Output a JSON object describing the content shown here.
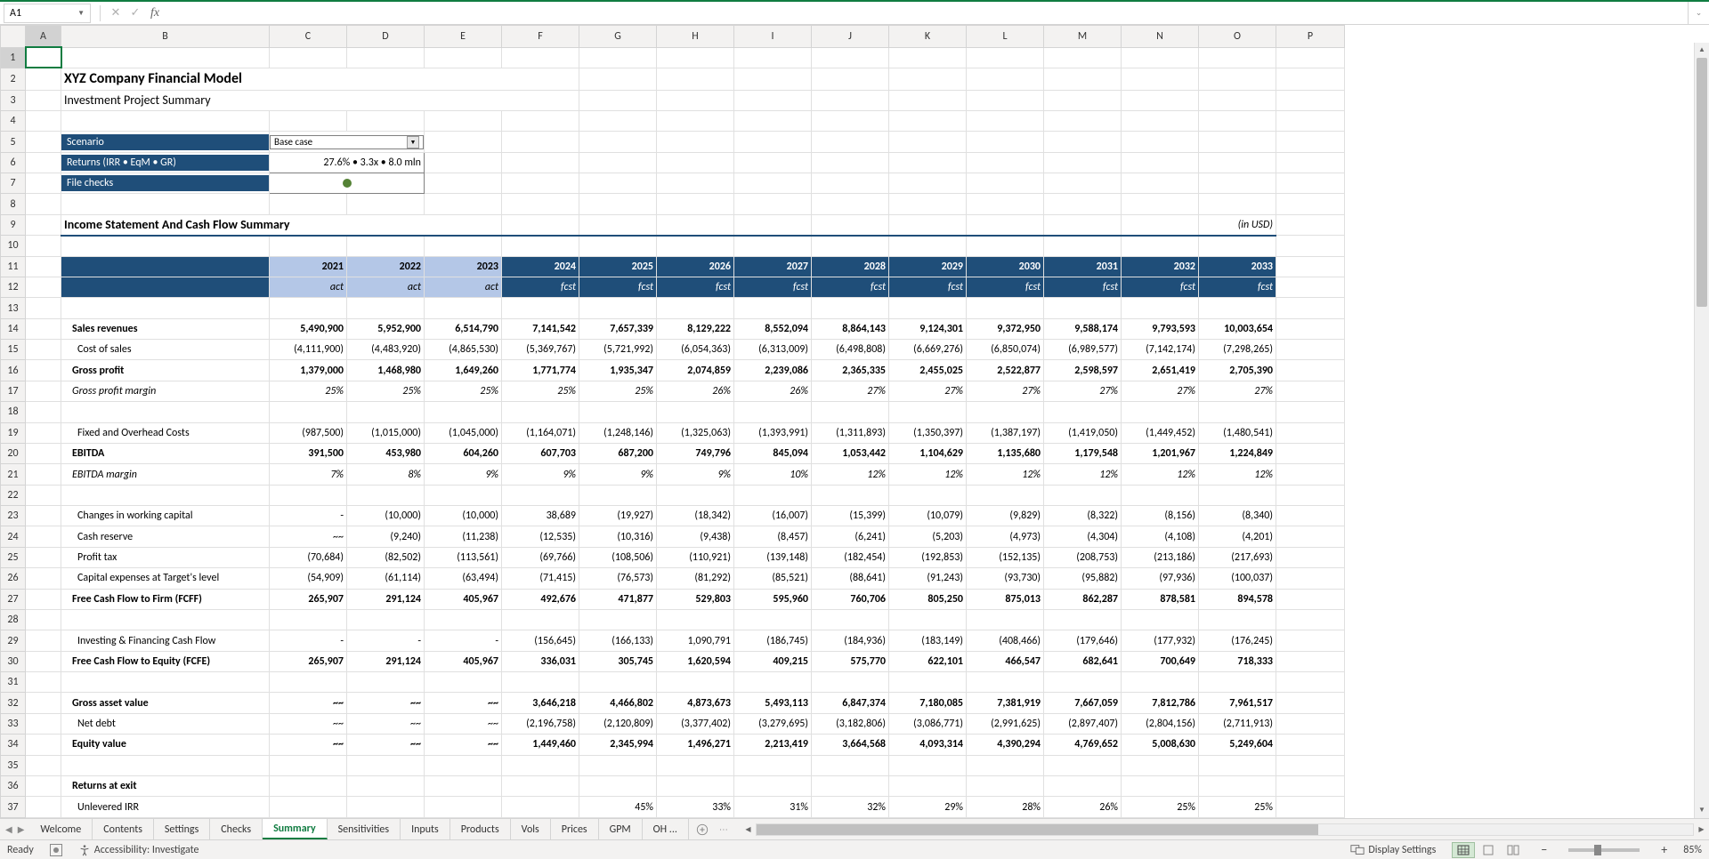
{
  "nameBox": "A1",
  "formula": "",
  "columns": [
    "A",
    "B",
    "C",
    "D",
    "E",
    "F",
    "G",
    "H",
    "I",
    "J",
    "K",
    "L",
    "M",
    "N",
    "O",
    "P"
  ],
  "title": "XYZ Company Financial Model",
  "subtitle": "Investment Project Summary",
  "scenario": {
    "label": "Scenario",
    "value": "Base case"
  },
  "returns": {
    "label": "Returns (IRR • EqM • GR)",
    "value": "27.6% • 3.3x • 8.0 mln"
  },
  "fileChecks": {
    "label": "File checks"
  },
  "sectionHeader": "Income Statement And Cash Flow Summary",
  "currency": "(in USD)",
  "years": [
    "2021",
    "2022",
    "2023",
    "2024",
    "2025",
    "2026",
    "2027",
    "2028",
    "2029",
    "2030",
    "2031",
    "2032",
    "2033"
  ],
  "yearTypes": [
    "act",
    "act",
    "act",
    "fcst",
    "fcst",
    "fcst",
    "fcst",
    "fcst",
    "fcst",
    "fcst",
    "fcst",
    "fcst",
    "fcst"
  ],
  "rows": [
    {
      "r": 14,
      "label": "Sales revenues",
      "bold": true,
      "ind": 0,
      "vals": [
        "5,490,900",
        "5,952,900",
        "6,514,790",
        "7,141,542",
        "7,657,339",
        "8,129,222",
        "8,552,094",
        "8,864,143",
        "9,124,301",
        "9,372,950",
        "9,588,174",
        "9,793,593",
        "10,003,654"
      ]
    },
    {
      "r": 15,
      "label": "Cost of sales",
      "ind": 1,
      "vals": [
        "(4,111,900)",
        "(4,483,920)",
        "(4,865,530)",
        "(5,369,767)",
        "(5,721,992)",
        "(6,054,363)",
        "(6,313,009)",
        "(6,498,808)",
        "(6,669,276)",
        "(6,850,074)",
        "(6,989,577)",
        "(7,142,174)",
        "(7,298,265)"
      ]
    },
    {
      "r": 16,
      "label": "Gross profit",
      "bold": true,
      "bt": true,
      "ind": 0,
      "vals": [
        "1,379,000",
        "1,468,980",
        "1,649,260",
        "1,771,774",
        "1,935,347",
        "2,074,859",
        "2,239,086",
        "2,365,335",
        "2,455,025",
        "2,522,877",
        "2,598,597",
        "2,651,419",
        "2,705,390"
      ]
    },
    {
      "r": 17,
      "label": "Gross profit margin",
      "ital": true,
      "ind": 0,
      "vals": [
        "25%",
        "25%",
        "25%",
        "25%",
        "25%",
        "26%",
        "26%",
        "27%",
        "27%",
        "27%",
        "27%",
        "27%",
        "27%"
      ]
    },
    {
      "r": 18,
      "blank": true
    },
    {
      "r": 19,
      "label": "Fixed and Overhead Costs",
      "ind": 1,
      "vals": [
        "(987,500)",
        "(1,015,000)",
        "(1,045,000)",
        "(1,164,071)",
        "(1,248,146)",
        "(1,325,063)",
        "(1,393,991)",
        "(1,311,893)",
        "(1,350,397)",
        "(1,387,197)",
        "(1,419,050)",
        "(1,449,452)",
        "(1,480,541)"
      ]
    },
    {
      "r": 20,
      "label": "EBITDA",
      "bold": true,
      "bt": true,
      "ind": 0,
      "vals": [
        "391,500",
        "453,980",
        "604,260",
        "607,703",
        "687,200",
        "749,796",
        "845,094",
        "1,053,442",
        "1,104,629",
        "1,135,680",
        "1,179,548",
        "1,201,967",
        "1,224,849"
      ]
    },
    {
      "r": 21,
      "label": "EBITDA margin",
      "ital": true,
      "ind": 0,
      "vals": [
        "7%",
        "8%",
        "9%",
        "9%",
        "9%",
        "9%",
        "10%",
        "12%",
        "12%",
        "12%",
        "12%",
        "12%",
        "12%"
      ]
    },
    {
      "r": 22,
      "blank": true
    },
    {
      "r": 23,
      "label": "Changes in working capital",
      "ind": 1,
      "vals": [
        "-",
        "(10,000)",
        "(10,000)",
        "38,689",
        "(19,927)",
        "(18,342)",
        "(16,007)",
        "(15,399)",
        "(10,079)",
        "(9,829)",
        "(8,322)",
        "(8,156)",
        "(8,340)"
      ]
    },
    {
      "r": 24,
      "label": "Cash reserve",
      "ind": 1,
      "vals": [
        "~~",
        "(9,240)",
        "(11,238)",
        "(12,535)",
        "(10,316)",
        "(9,438)",
        "(8,457)",
        "(6,241)",
        "(5,203)",
        "(4,973)",
        "(4,304)",
        "(4,108)",
        "(4,201)"
      ]
    },
    {
      "r": 25,
      "label": "Profit tax",
      "ind": 1,
      "vals": [
        "(70,684)",
        "(82,502)",
        "(113,561)",
        "(69,766)",
        "(108,506)",
        "(110,921)",
        "(139,148)",
        "(182,454)",
        "(192,853)",
        "(152,135)",
        "(208,753)",
        "(213,186)",
        "(217,693)"
      ]
    },
    {
      "r": 26,
      "label": "Capital expenses at Target's level",
      "ind": 1,
      "vals": [
        "(54,909)",
        "(61,114)",
        "(63,494)",
        "(71,415)",
        "(76,573)",
        "(81,292)",
        "(85,521)",
        "(88,641)",
        "(91,243)",
        "(93,730)",
        "(95,882)",
        "(97,936)",
        "(100,037)"
      ]
    },
    {
      "r": 27,
      "label": "Free Cash Flow to Firm (FCFF)",
      "bold": true,
      "bt": true,
      "ind": 0,
      "vals": [
        "265,907",
        "291,124",
        "405,967",
        "492,676",
        "471,877",
        "529,803",
        "595,960",
        "760,706",
        "805,250",
        "875,013",
        "862,287",
        "878,581",
        "894,578"
      ]
    },
    {
      "r": 28,
      "blank": true
    },
    {
      "r": 29,
      "label": "Investing & Financing Cash Flow",
      "ind": 1,
      "vals": [
        "-",
        "-",
        "-",
        "(156,645)",
        "(166,133)",
        "1,090,791",
        "(186,745)",
        "(184,936)",
        "(183,149)",
        "(408,466)",
        "(179,646)",
        "(177,932)",
        "(176,245)"
      ]
    },
    {
      "r": 30,
      "label": "Free Cash Flow to Equity (FCFE)",
      "bold": true,
      "bt": true,
      "ind": 0,
      "vals": [
        "265,907",
        "291,124",
        "405,967",
        "336,031",
        "305,745",
        "1,620,594",
        "409,215",
        "575,770",
        "622,101",
        "466,547",
        "682,641",
        "700,649",
        "718,333"
      ]
    },
    {
      "r": 31,
      "blank": true
    },
    {
      "r": 32,
      "label": "Gross asset value",
      "bold": true,
      "ind": 0,
      "vals": [
        "~~",
        "~~",
        "~~",
        "3,646,218",
        "4,466,802",
        "4,873,673",
        "5,493,113",
        "6,847,374",
        "7,180,085",
        "7,381,919",
        "7,667,059",
        "7,812,786",
        "7,961,517"
      ]
    },
    {
      "r": 33,
      "label": "Net debt",
      "ind": 1,
      "vals": [
        "~~",
        "~~",
        "~~",
        "(2,196,758)",
        "(2,120,809)",
        "(3,377,402)",
        "(3,279,695)",
        "(3,182,806)",
        "(3,086,771)",
        "(2,991,625)",
        "(2,897,407)",
        "(2,804,156)",
        "(2,711,913)"
      ]
    },
    {
      "r": 34,
      "label": "Equity value",
      "bold": true,
      "bt": true,
      "ind": 0,
      "vals": [
        "~~",
        "~~",
        "~~",
        "1,449,460",
        "2,345,994",
        "1,496,271",
        "2,213,419",
        "3,664,568",
        "4,093,314",
        "4,390,294",
        "4,769,652",
        "5,008,630",
        "5,249,604"
      ]
    },
    {
      "r": 35,
      "blank": true
    },
    {
      "r": 36,
      "label": "Returns at exit",
      "bold": true,
      "ind": 0,
      "vals": [
        "",
        "",
        "",
        "",
        "",
        "",
        "",
        "",
        "",
        "",
        "",
        "",
        ""
      ]
    },
    {
      "r": 37,
      "label": "Unlevered IRR",
      "ind": 1,
      "vals": [
        "",
        "",
        "",
        "",
        "45%",
        "33%",
        "31%",
        "32%",
        "29%",
        "28%",
        "26%",
        "25%",
        "25%"
      ]
    }
  ],
  "sheetTabs": [
    "Welcome",
    "Contents",
    "Settings",
    "Checks",
    "Summary",
    "Sensitivities",
    "Inputs",
    "Products",
    "Vols",
    "Prices",
    "GPM",
    "OH ..."
  ],
  "activeTab": "Summary",
  "status": {
    "ready": "Ready",
    "acc": "Accessibility: Investigate",
    "display": "Display Settings",
    "zoom": "85%"
  }
}
